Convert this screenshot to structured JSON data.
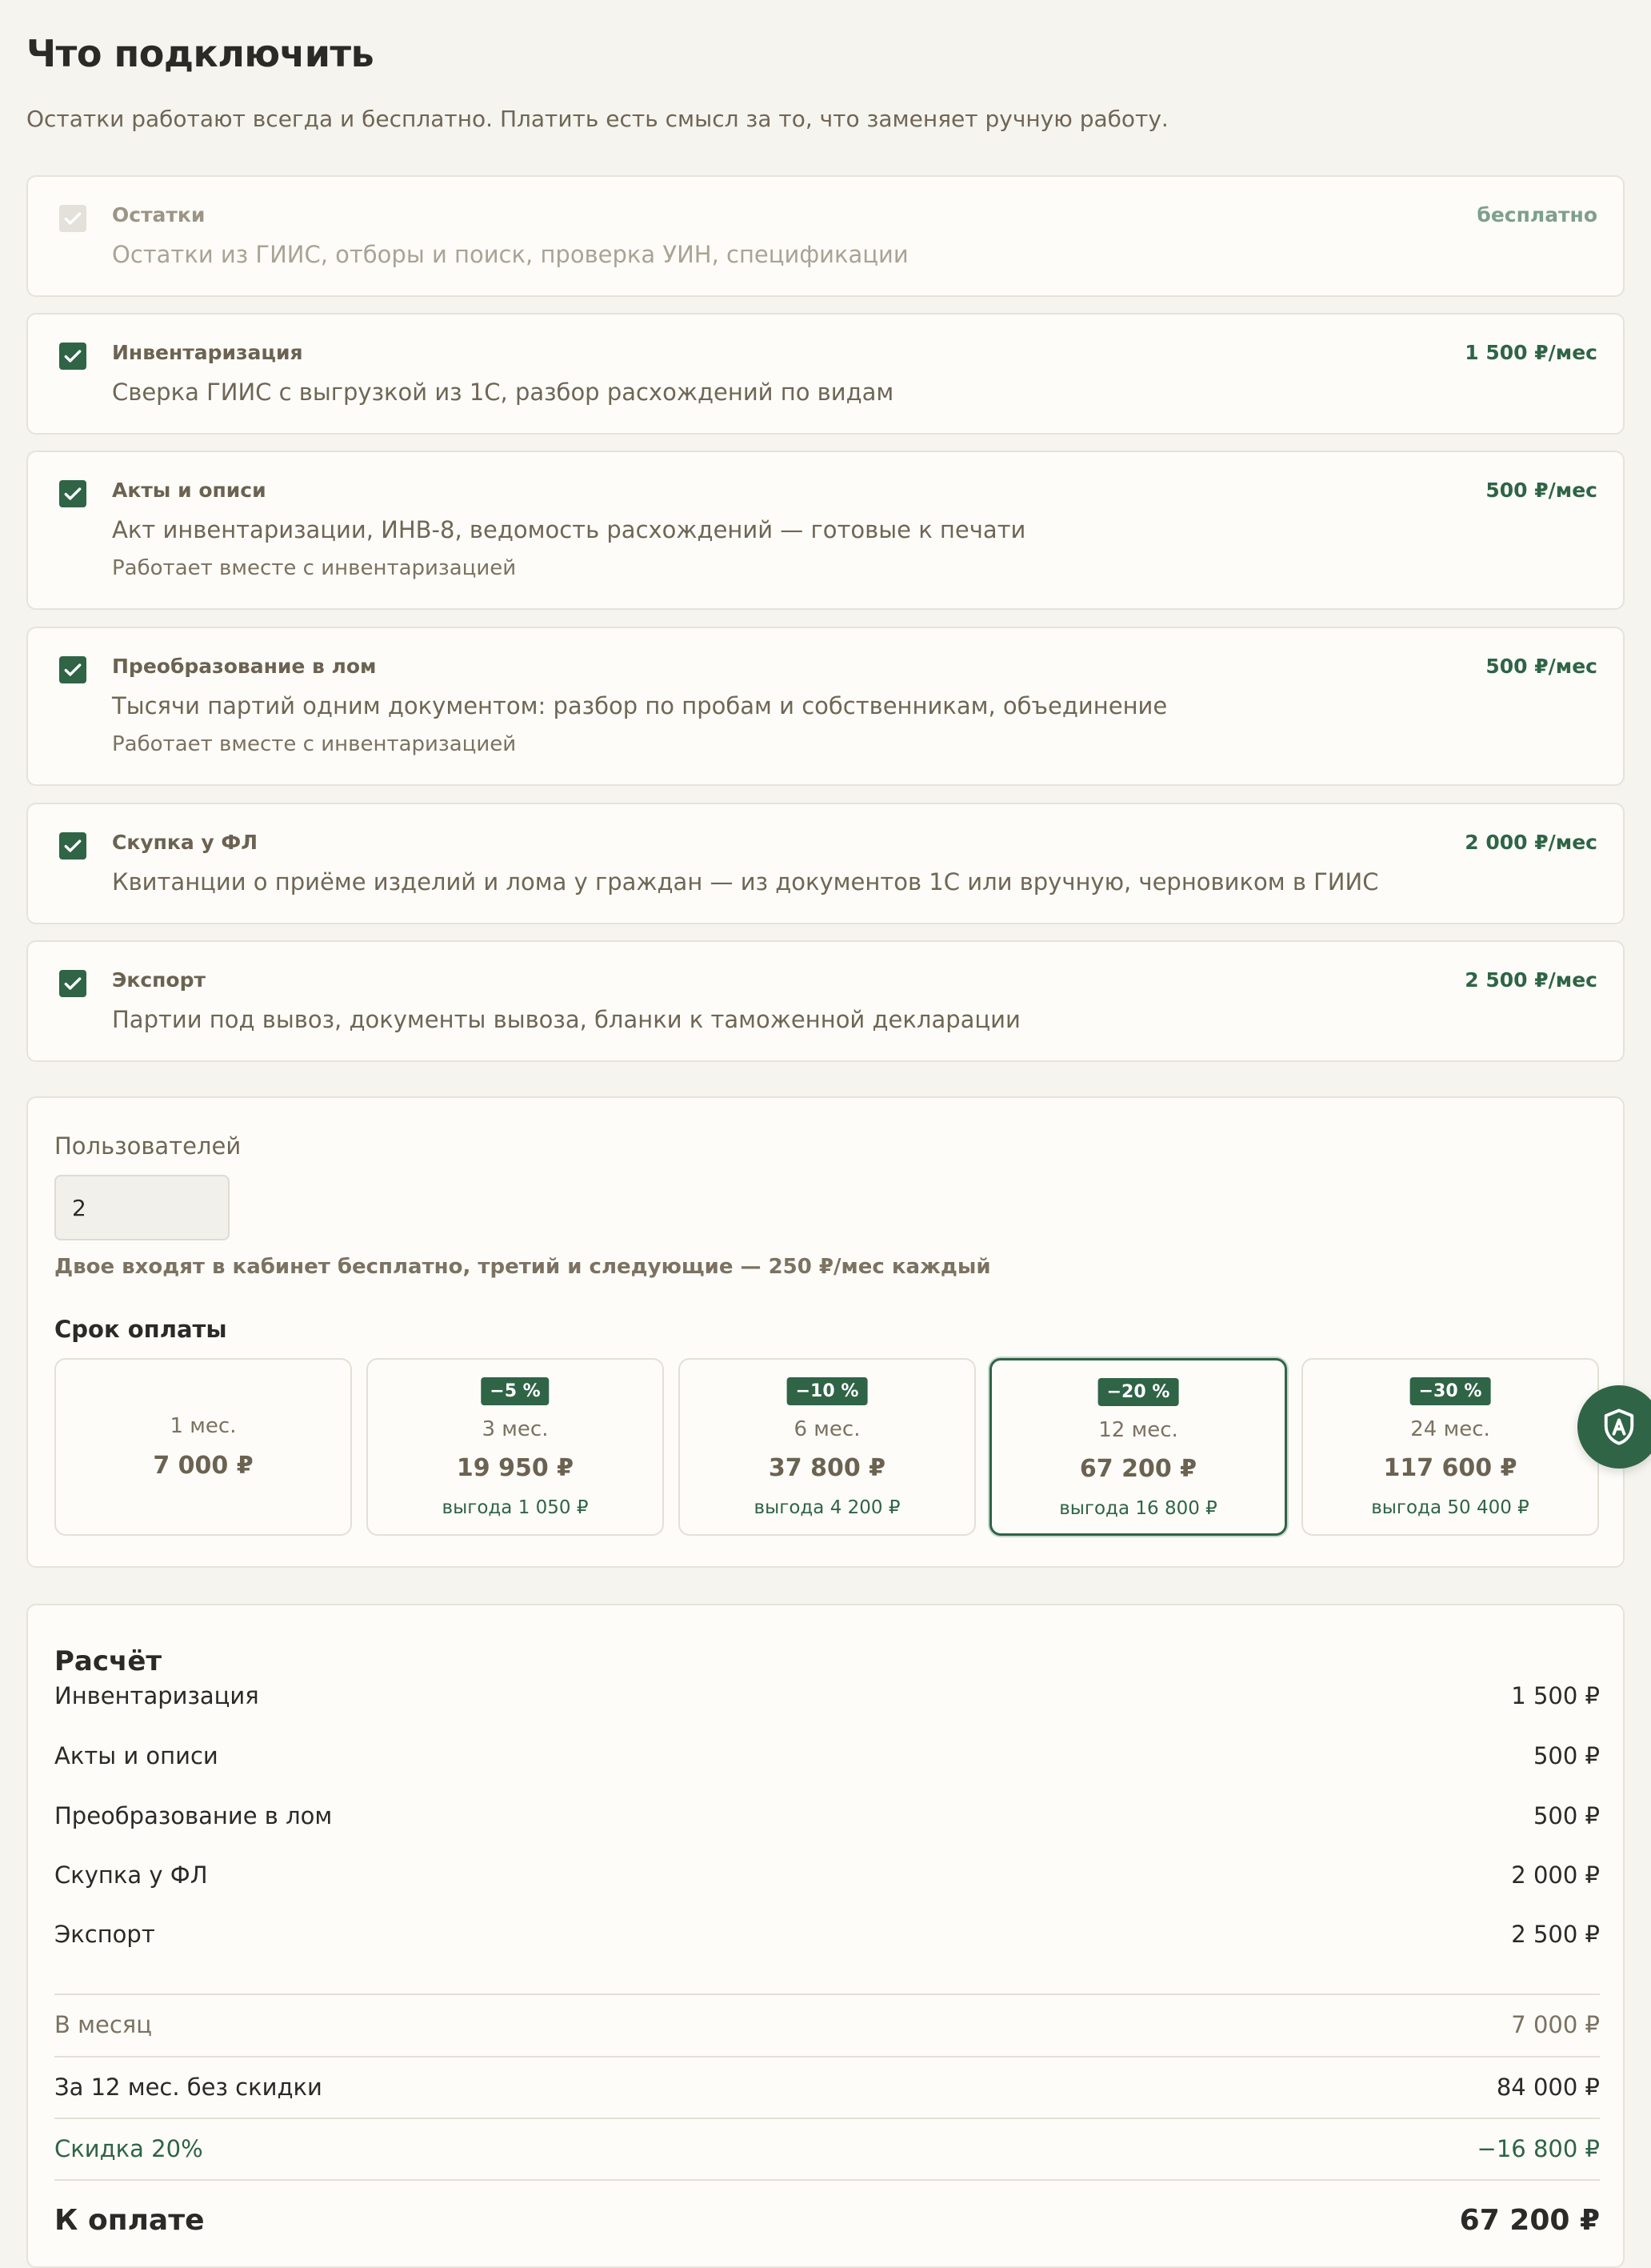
{
  "header": {
    "title": "Что подключить",
    "subtitle": "Остатки работают всегда и бесплатно. Платить есть смысл за то, что заменяет ручную работу."
  },
  "options": [
    {
      "name": "Остатки",
      "price": "бесплатно",
      "desc": "Остатки из ГИИС, отборы и поиск, проверка УИН, спецификации",
      "note": "",
      "checked": true,
      "disabled": true
    },
    {
      "name": "Инвентаризация",
      "price": "1 500 ₽/мес",
      "desc": "Сверка ГИИС с выгрузкой из 1С, разбор расхождений по видам",
      "note": "",
      "checked": true,
      "disabled": false
    },
    {
      "name": "Акты и описи",
      "price": "500 ₽/мес",
      "desc": "Акт инвентаризации, ИНВ-8, ведомость расхождений — готовые к печати",
      "note": "Работает вместе с инвентаризацией",
      "checked": true,
      "disabled": false
    },
    {
      "name": "Преобразование в лом",
      "price": "500 ₽/мес",
      "desc": "Тысячи партий одним документом: разбор по пробам и собственникам, объединение",
      "note": "Работает вместе с инвентаризацией",
      "checked": true,
      "disabled": false
    },
    {
      "name": "Скупка у ФЛ",
      "price": "2 000 ₽/мес",
      "desc": "Квитанции о приёме изделий и лома у граждан — из документов 1С или вручную, черновиком в ГИИС",
      "note": "",
      "checked": true,
      "disabled": false
    },
    {
      "name": "Экспорт",
      "price": "2 500 ₽/мес",
      "desc": "Партии под вывоз, документы вывоза, бланки к таможенной декларации",
      "note": "",
      "checked": true,
      "disabled": false
    }
  ],
  "users": {
    "label": "Пользователей",
    "value": "2",
    "hint": "Двое входят в кабинет бесплатно, третий и следующие — 250 ₽/мес каждый"
  },
  "term": {
    "label": "Срок оплаты",
    "selected_index": 3,
    "options": [
      {
        "badge": "",
        "months": "1 мес.",
        "total": "7 000 ₽",
        "saving": ""
      },
      {
        "badge": "−5 %",
        "months": "3 мес.",
        "total": "19 950 ₽",
        "saving": "выгода 1 050 ₽"
      },
      {
        "badge": "−10 %",
        "months": "6 мес.",
        "total": "37 800 ₽",
        "saving": "выгода 4 200 ₽"
      },
      {
        "badge": "−20 %",
        "months": "12 мес.",
        "total": "67 200 ₽",
        "saving": "выгода 16 800 ₽"
      },
      {
        "badge": "−30 %",
        "months": "24 мес.",
        "total": "117 600 ₽",
        "saving": "выгода 50 400 ₽"
      }
    ]
  },
  "calc": {
    "title": "Расчёт",
    "items": [
      {
        "label": "Инвентаризация",
        "value": "1 500 ₽"
      },
      {
        "label": "Акты и описи",
        "value": "500 ₽"
      },
      {
        "label": "Преобразование в лом",
        "value": "500 ₽"
      },
      {
        "label": "Скупка у ФЛ",
        "value": "2 000 ₽"
      },
      {
        "label": "Экспорт",
        "value": "2 500 ₽"
      }
    ],
    "monthly": {
      "label": "В месяц",
      "value": "7 000 ₽"
    },
    "no_discount": {
      "label": "За 12 мес. без скидки",
      "value": "84 000 ₽"
    },
    "discount": {
      "label": "Скидка 20%",
      "value": "−16 800 ₽"
    },
    "total": {
      "label": "К оплате",
      "value": "67 200 ₽"
    }
  },
  "colors": {
    "accent": "#2f6446",
    "background": "#f5f4ef",
    "card": "#fdfcf8"
  },
  "icons": {
    "checkbox": "check-icon",
    "floating": "shield-a-icon"
  }
}
